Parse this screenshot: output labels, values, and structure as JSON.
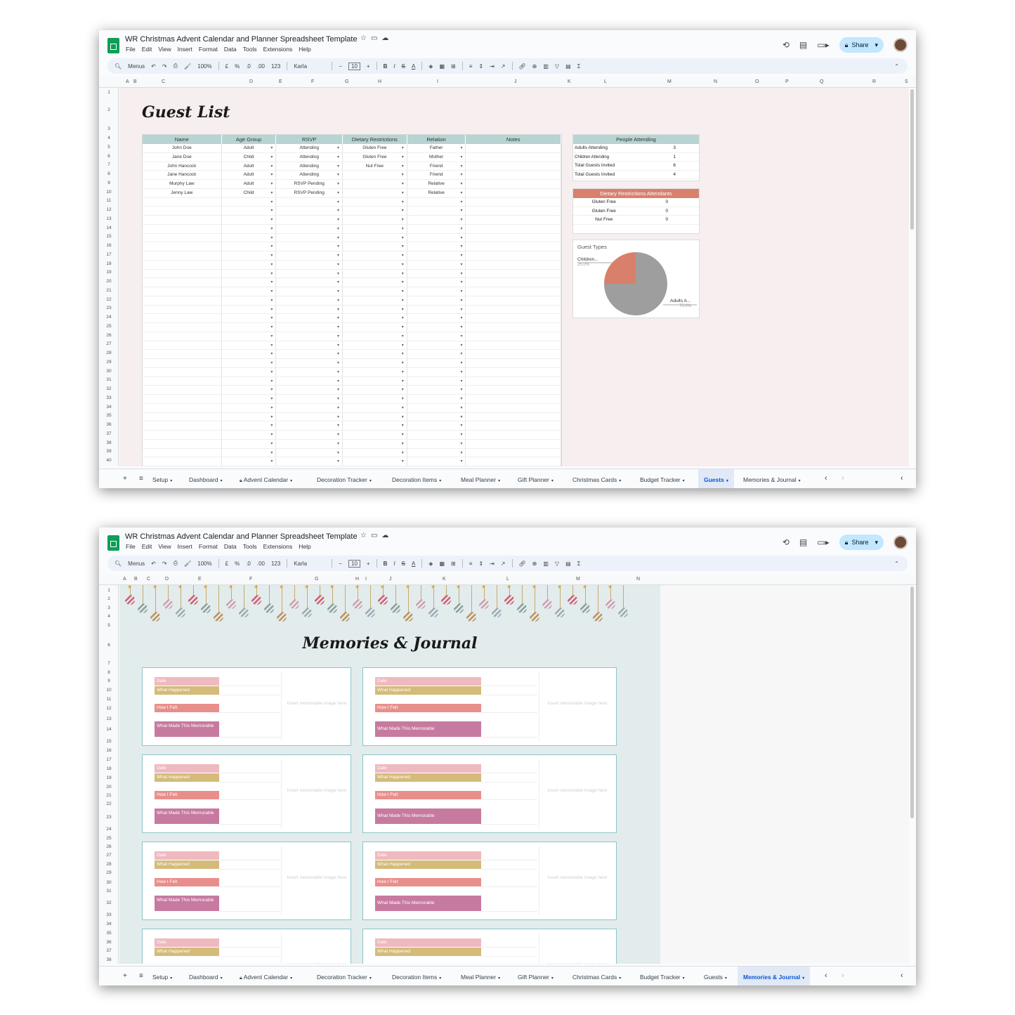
{
  "app": {
    "title": "WR Christmas Advent Calendar and Planner Spreadsheet Template",
    "menus": [
      "File",
      "Edit",
      "View",
      "Insert",
      "Format",
      "Data",
      "Tools",
      "Extensions",
      "Help"
    ],
    "share_label": "Share"
  },
  "toolbar": {
    "search": "Menus",
    "zoom": "100%",
    "currency": "£",
    "percent": "%",
    "dec_less": ".0",
    "dec_more": ".00",
    "num_format": "123",
    "font": "Karla",
    "font_size": "10",
    "minus": "−",
    "plus": "+",
    "bold": "B",
    "italic": "I",
    "strike": "S",
    "textcolor": "A",
    "sigma": "Σ"
  },
  "tabs": [
    "Setup",
    "Dashboard",
    "Advent Calendar",
    "Decoration Tracker",
    "Decoration Items",
    "Meal Planner",
    "Gift Planner",
    "Christmas Cards",
    "Budget Tracker",
    "Guests",
    "Memories & Journal"
  ],
  "window1": {
    "active_tab": "Guests",
    "columns": [
      "A",
      "B",
      "C",
      "D",
      "E",
      "F",
      "G",
      "H",
      "I",
      "J",
      "K",
      "L",
      "M",
      "N",
      "O",
      "P",
      "Q",
      "R",
      "S"
    ],
    "rows": [
      "1",
      "2",
      "3",
      "4",
      "5",
      "6",
      "7",
      "8",
      "9",
      "10",
      "11",
      "12",
      "13",
      "14",
      "15",
      "16",
      "17",
      "18",
      "19",
      "20",
      "21",
      "22",
      "23",
      "24",
      "25",
      "26",
      "27",
      "28",
      "29",
      "30",
      "31",
      "32",
      "33",
      "34",
      "35",
      "36",
      "37",
      "38",
      "39",
      "40"
    ],
    "title": "Guest List",
    "headers": [
      "Name",
      "Age Group",
      "RSVP",
      "Dietary Restrictions",
      "Relation",
      "Notes"
    ],
    "guests": [
      [
        "John Doe",
        "Adult",
        "Attending",
        "Gluten Free",
        "Father",
        ""
      ],
      [
        "Jane Doe",
        "Child",
        "Attending",
        "Gluten Free",
        "Mother",
        ""
      ],
      [
        "John Hancock",
        "Adult",
        "Attending",
        "Nut Free",
        "Friend",
        ""
      ],
      [
        "Jane Hancock",
        "Adult",
        "Attending",
        "",
        "Friend",
        ""
      ],
      [
        "Murphy Law",
        "Adult",
        "RSVP Pending",
        "",
        "Relative",
        ""
      ],
      [
        "Jenny Law",
        "Child",
        "RSVP Pending",
        "",
        "Relative",
        ""
      ]
    ],
    "people_attending": {
      "title": "People Attending",
      "rows": [
        [
          "Adults Attending",
          "3"
        ],
        [
          "Children Attending",
          "1"
        ],
        [
          "Total Guests Invited",
          "6"
        ],
        [
          "Total Guests Invited",
          "4"
        ]
      ]
    },
    "dietary": {
      "title": "Dietary Restrictions Attendants",
      "rows": [
        [
          "Gluten Free",
          "0"
        ],
        [
          "Gluten Free",
          "0"
        ],
        [
          "Nut Free",
          "0"
        ]
      ]
    },
    "pie": {
      "title": "Guest Types",
      "label_a": "Children...",
      "pct_a": "25.0%",
      "label_b": "Adults A...",
      "pct_b": "75.0%"
    }
  },
  "chart_data": {
    "type": "pie",
    "title": "Guest Types",
    "categories": [
      "Children...",
      "Adults A..."
    ],
    "values": [
      25.0,
      75.0
    ],
    "colors": [
      "#d9806c",
      "#9e9e9e"
    ]
  },
  "window2": {
    "active_tab": "Memories & Journal",
    "columns": [
      "A",
      "B",
      "C",
      "D",
      "E",
      "F",
      "G",
      "H",
      "I",
      "J",
      "K",
      "L",
      "M",
      "N"
    ],
    "rows": [
      "1",
      "2",
      "3",
      "4",
      "5",
      "6",
      "7",
      "8",
      "9",
      "10",
      "11",
      "12",
      "13",
      "14",
      "15",
      "16",
      "17",
      "18",
      "19",
      "20",
      "21",
      "22",
      "23",
      "24",
      "25",
      "26",
      "27",
      "28",
      "29",
      "30",
      "31",
      "32",
      "33",
      "34",
      "35",
      "36",
      "37",
      "38"
    ],
    "title": "Memories & Journal",
    "labels": {
      "date": "Date",
      "what": "What Happened",
      "felt": "How I Felt",
      "memorable_left": "What Made This Memorable",
      "memorable_right": "What Made This Memorable",
      "image": "Insert memorable image here"
    }
  },
  "colors": {
    "header_teal": "#b7d4d2",
    "diet_header": "#d9806c",
    "date_pink": "#efb9c0",
    "what_gold": "#d4bb7a",
    "felt_coral": "#e88f8c",
    "memorable_mauve": "#c77a9f",
    "share_bg": "#c2e7ff"
  }
}
